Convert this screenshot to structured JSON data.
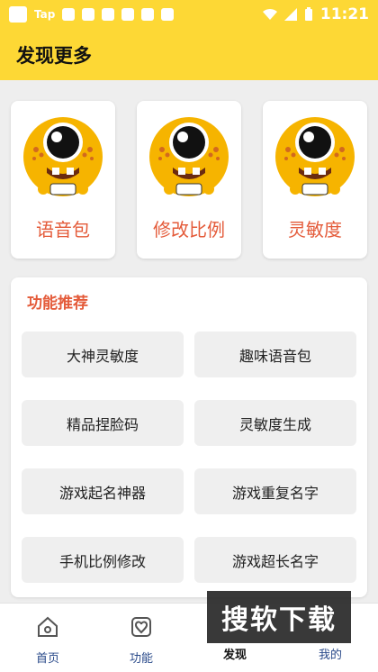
{
  "statusbar": {
    "app_tag": "Tap",
    "time": "11:21"
  },
  "header": {
    "title": "发现更多",
    "bg": "#fdd835"
  },
  "top_cards": [
    {
      "label": "语音包",
      "icon": "mascot-icon"
    },
    {
      "label": "修改比例",
      "icon": "mascot-icon"
    },
    {
      "label": "灵敏度",
      "icon": "mascot-icon"
    }
  ],
  "feature_panel": {
    "title": "功能推荐",
    "buttons": [
      "大神灵敏度",
      "趣味语音包",
      "精品捏脸码",
      "灵敏度生成",
      "游戏起名神器",
      "游戏重复名字",
      "手机比例修改",
      "游戏超长名字"
    ]
  },
  "bottom_nav": {
    "items": [
      {
        "label": "首页",
        "icon": "home-icon",
        "active": false
      },
      {
        "label": "功能",
        "icon": "heart-box-icon",
        "active": false
      },
      {
        "label": "发现",
        "icon": "discover-icon",
        "active": true
      },
      {
        "label": "我的",
        "icon": "profile-icon",
        "active": false
      }
    ]
  },
  "watermark": {
    "text": "搜软下载"
  },
  "colors": {
    "accent": "#e45b3a",
    "brand_yellow": "#fdd835",
    "nav_text": "#2a4a8a"
  }
}
